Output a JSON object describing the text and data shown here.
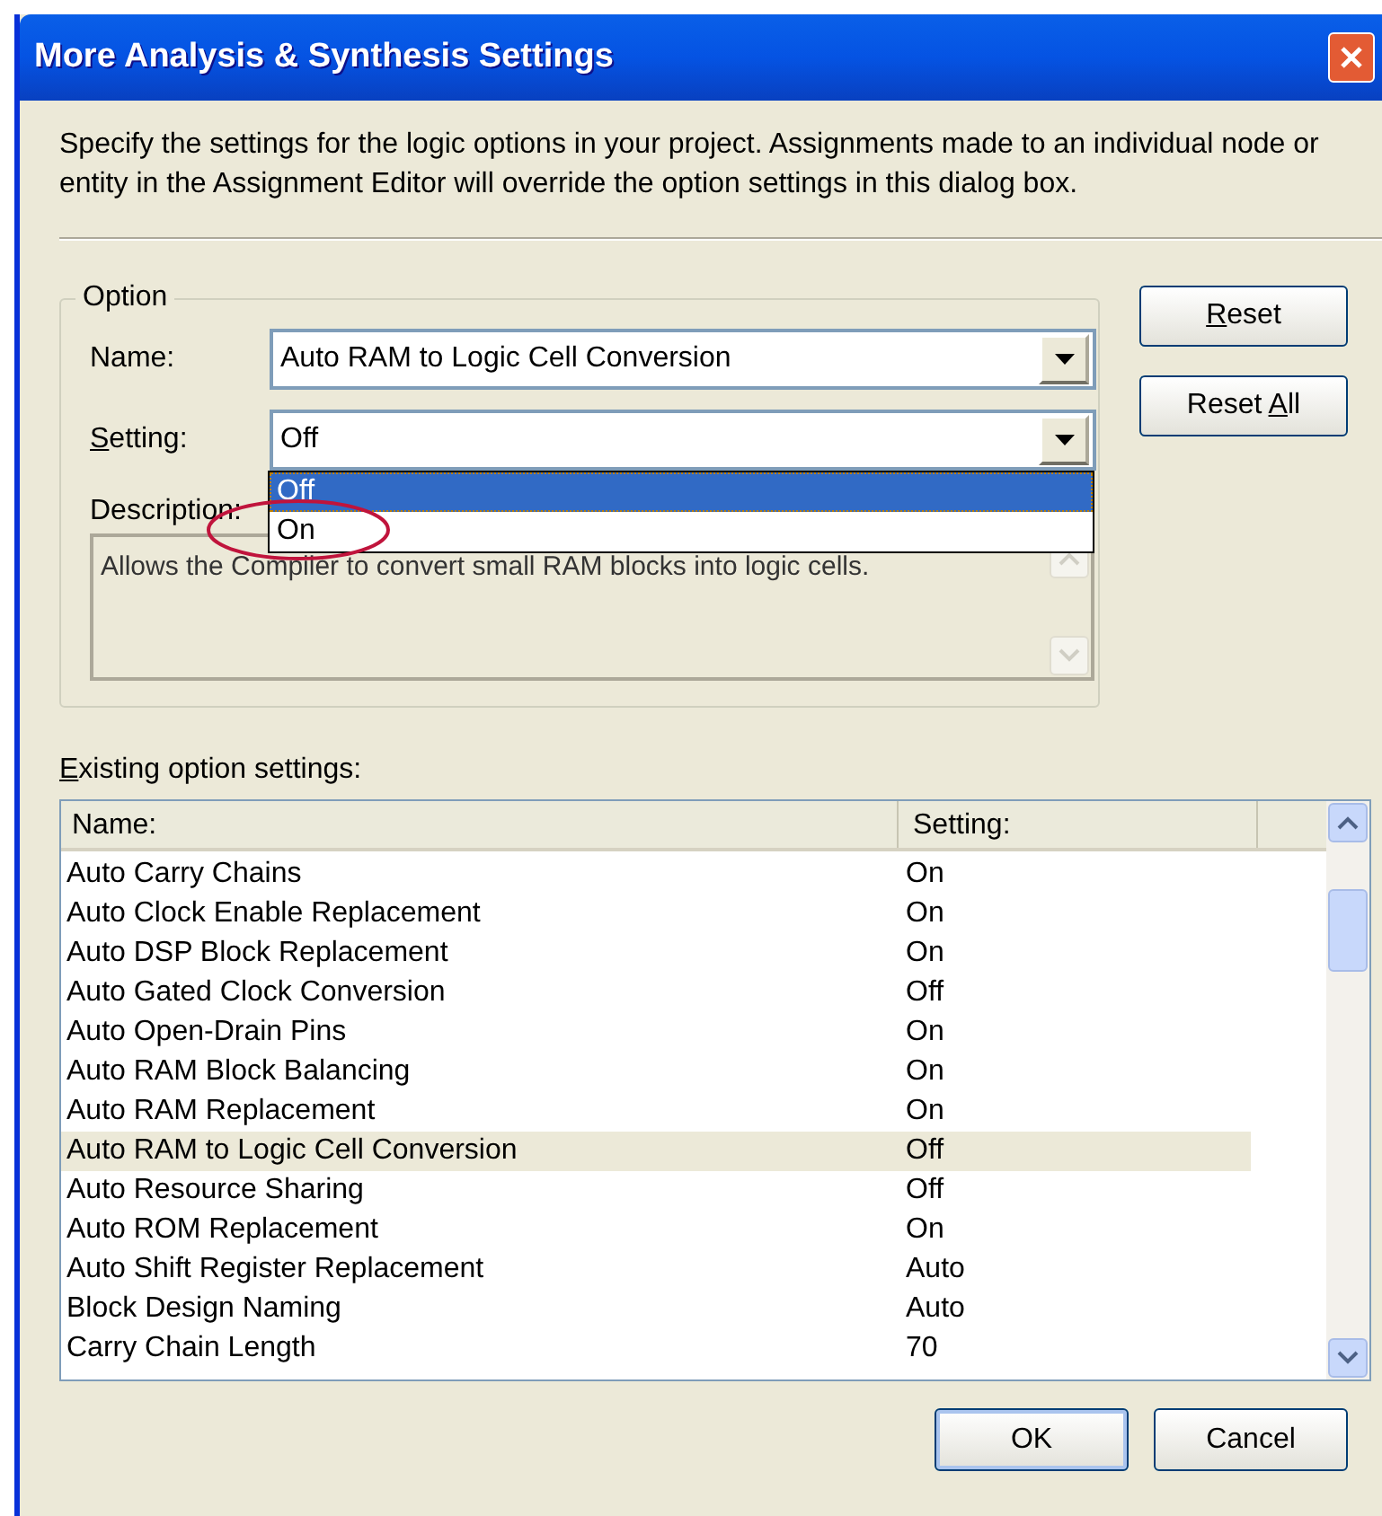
{
  "window": {
    "title": "More Analysis & Synthesis Settings"
  },
  "intro": "Specify the settings for the logic options in your project.  Assignments made to an individual node or entity in the Assignment Editor will override the option settings in this dialog box.",
  "option_group": {
    "title": "Option",
    "name_field": {
      "label": "Name:",
      "value": "Auto RAM to Logic Cell Conversion"
    },
    "setting_field": {
      "label_parts": [
        {
          "text": "S",
          "underline": true
        },
        {
          "text": "etting:",
          "underline": false
        }
      ],
      "value": "Off",
      "expanded": true,
      "options": [
        {
          "label": "Off",
          "selected": true
        },
        {
          "label": "On",
          "selected": false
        }
      ]
    },
    "description": {
      "label": "Description:",
      "text": "Allows the Compiler to convert small RAM blocks into logic cells."
    }
  },
  "side_buttons": [
    {
      "label_parts": [
        {
          "text": "R",
          "underline": true
        },
        {
          "text": "eset",
          "underline": false
        }
      ]
    },
    {
      "label_parts": [
        {
          "text": "Reset ",
          "underline": false
        },
        {
          "text": "A",
          "underline": true
        },
        {
          "text": "ll",
          "underline": false
        }
      ]
    }
  ],
  "existing": {
    "label_parts": [
      {
        "text": "E",
        "underline": true
      },
      {
        "text": "xisting option settings:",
        "underline": false
      }
    ],
    "columns": [
      "Name:",
      "Setting:"
    ],
    "rows": [
      {
        "name": "Auto Carry Chains",
        "setting": "On",
        "selected": false
      },
      {
        "name": "Auto Clock Enable Replacement",
        "setting": "On",
        "selected": false
      },
      {
        "name": "Auto DSP Block Replacement",
        "setting": "On",
        "selected": false
      },
      {
        "name": "Auto Gated Clock Conversion",
        "setting": "Off",
        "selected": false
      },
      {
        "name": "Auto Open-Drain Pins",
        "setting": "On",
        "selected": false
      },
      {
        "name": "Auto RAM Block Balancing",
        "setting": "On",
        "selected": false
      },
      {
        "name": "Auto RAM Replacement",
        "setting": "On",
        "selected": false
      },
      {
        "name": "Auto RAM to Logic Cell Conversion",
        "setting": "Off",
        "selected": true
      },
      {
        "name": "Auto Resource Sharing",
        "setting": "Off",
        "selected": false
      },
      {
        "name": "Auto ROM Replacement",
        "setting": "On",
        "selected": false
      },
      {
        "name": "Auto Shift Register Replacement",
        "setting": "Auto",
        "selected": false
      },
      {
        "name": "Block Design Naming",
        "setting": "Auto",
        "selected": false
      },
      {
        "name": "Carry Chain Length",
        "setting": "70",
        "selected": false
      }
    ]
  },
  "buttons": [
    "OK",
    "Cancel"
  ]
}
